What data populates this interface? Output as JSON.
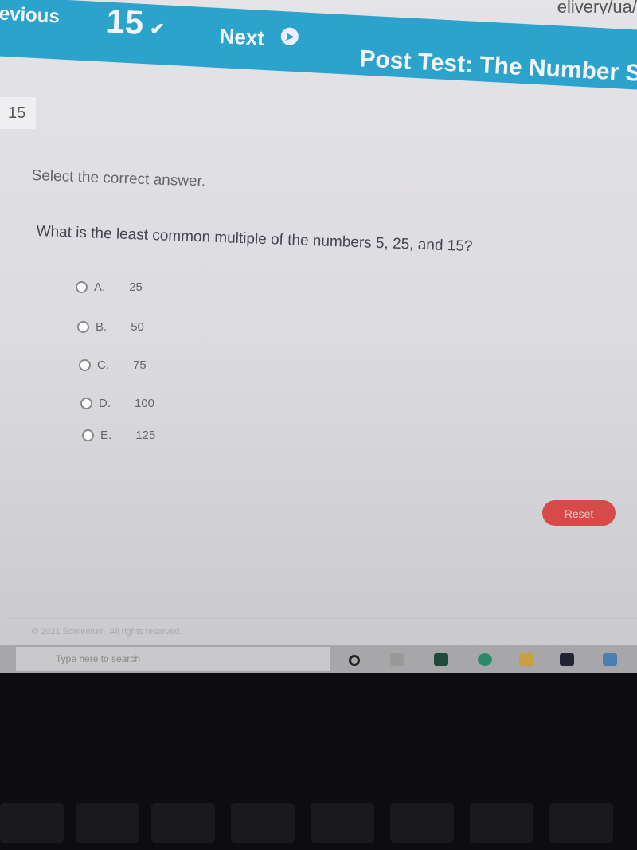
{
  "browser": {
    "url_fragment": "elivery/ua/"
  },
  "nav": {
    "previous_label": "evious",
    "question_number": "15",
    "next_label": "Next",
    "test_title": "Post Test: The Number Sy"
  },
  "question": {
    "badge": "15",
    "instruction": "Select the correct answer.",
    "prompt": "What is the least common multiple of the numbers 5, 25, and 15?",
    "options": [
      {
        "letter": "A.",
        "value": "25"
      },
      {
        "letter": "B.",
        "value": "50"
      },
      {
        "letter": "C.",
        "value": "75"
      },
      {
        "letter": "D.",
        "value": "100"
      },
      {
        "letter": "E.",
        "value": "125"
      }
    ],
    "reset_label": "Reset"
  },
  "footer": {
    "copyright": "© 2021 Edmentum. All rights reserved."
  },
  "taskbar": {
    "search_placeholder": "Type here to search"
  },
  "colors": {
    "accent": "#2ba3cc",
    "reset": "#d64a4a"
  }
}
